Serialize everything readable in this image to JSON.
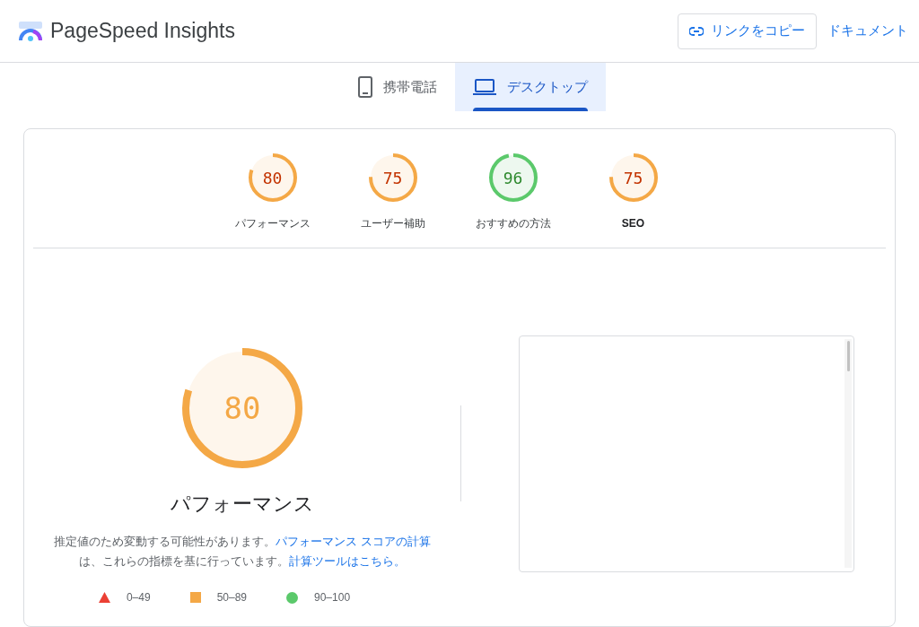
{
  "header": {
    "title": "PageSpeed Insights",
    "copy_button": "リンクをコピー",
    "docs_link": "ドキュメント"
  },
  "tabs": [
    {
      "label": "携帯電話",
      "kind": "phone",
      "selected": false
    },
    {
      "label": "デスクトップ",
      "kind": "laptop",
      "selected": true
    }
  ],
  "categories": [
    {
      "score": "80",
      "label": "パフォーマンス",
      "level": 0.8,
      "color": "#f4a846",
      "bold": false
    },
    {
      "score": "75",
      "label": "ユーザー補助",
      "level": 0.75,
      "color": "#f4a846",
      "bold": false
    },
    {
      "score": "96",
      "label": "おすすめの方法",
      "level": 0.96,
      "color": "#5bc96b",
      "bold": false
    },
    {
      "score": "75",
      "label": "SEO",
      "level": 0.75,
      "color": "#f4a846",
      "bold": true
    }
  ],
  "main_gauge": {
    "score": "80",
    "level": 0.8,
    "color": "#f4a846",
    "title": "パフォーマンス"
  },
  "description": [
    {
      "text": "推定値のため変動する可能性があります。",
      "link": false
    },
    {
      "text": "パフォーマンス スコアの計算",
      "link": true
    },
    {
      "text": "は、これらの指標を基に行っています。",
      "link": false
    },
    {
      "text": "計算ツールはこちら。",
      "link": true
    }
  ],
  "legend": [
    {
      "kind": "triangle",
      "range": "0–49",
      "color": "#eb4034"
    },
    {
      "kind": "square",
      "range": "50–89",
      "color": "#f4a846"
    },
    {
      "kind": "circle",
      "range": "90–100",
      "color": "#5bc96b"
    }
  ]
}
